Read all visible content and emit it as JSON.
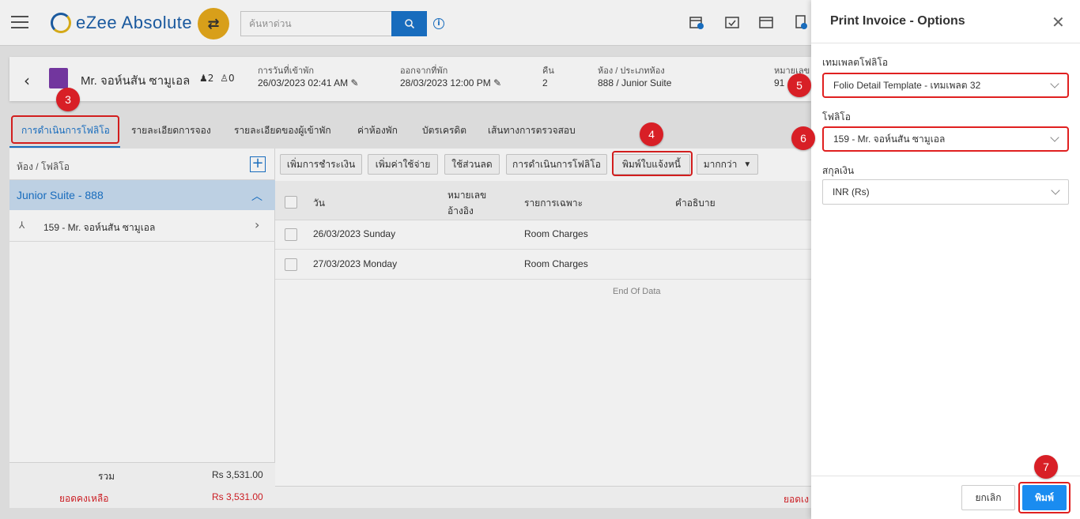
{
  "app": {
    "logo_text": "eZee Absolute",
    "search_placeholder": "ค้นหาด่วน"
  },
  "reservation": {
    "guest_name": "Mr. จอห์นสัน ซามูเอล",
    "adults": "2",
    "children": "0",
    "checkin_label": "การวันที่เข้าพัก",
    "checkin_value": "26/03/2023 02:41 AM",
    "checkout_label": "ออกจากที่พัก",
    "checkout_value": "28/03/2023 12:00 PM",
    "nights_label": "คืน",
    "nights_value": "2",
    "room_label": "ห้อง / ประเภทห้อง",
    "room_value": "888 / Junior Suite",
    "number_label": "หมายเลข",
    "number_value": "91"
  },
  "tabs": [
    "การดำเนินการโฟลิโอ",
    "รายละเอียดการจอง",
    "รายละเอียดของผู้เข้าพัก",
    "ค่าห้องพัก",
    "บัตรเครดิต",
    "เส้นทางการตรวจสอบ"
  ],
  "left": {
    "header": "ห้อง / โฟลิโอ",
    "room": "Junior Suite - 888",
    "folio": "159 - Mr. จอห์นสัน ซามูเอล",
    "total_label": "รวม",
    "total_value": "Rs 3,531.00",
    "balance_label": "ยอดคงเหลือ",
    "balance_value": "Rs 3,531.00"
  },
  "toolbar": [
    "เพิ่มการชำระเงิน",
    "เพิ่มค่าใช้จ่าย",
    "ใช้ส่วนลด",
    "การดำเนินการโฟลิโอ",
    "พิมพ์ใบแจ้งหนี้",
    "มากกว่า"
  ],
  "table": {
    "headers": {
      "date": "วัน",
      "ref1": "หมายเลข",
      "ref2": "อ้างอิง",
      "particulars": "รายการเฉพาะ",
      "description": "คำอธิบาย"
    },
    "rows": [
      {
        "date": "26/03/2023 Sunday",
        "particulars": "Room Charges"
      },
      {
        "date": "27/03/2023 Monday",
        "particulars": "Room Charges"
      }
    ],
    "end": "End Of Data",
    "footer_partial": "ยอดเง"
  },
  "panel": {
    "title": "Print Invoice - Options",
    "template_label": "เทมเพลตโฟลิโอ",
    "template_value": "Folio Detail Template - เทมเพลต 32",
    "folio_label": "โฟลิโอ",
    "folio_value": "159 - Mr. จอห์นสัน ซามูเอล",
    "currency_label": "สกุลเงิน",
    "currency_value": "INR (Rs)",
    "cancel": "ยกเลิก",
    "print": "พิมพ์"
  },
  "markers": [
    "3",
    "4",
    "5",
    "6",
    "7"
  ],
  "colors": {
    "accent": "#1a73c9",
    "marker": "#d81f26",
    "print": "#1a8cf0"
  }
}
